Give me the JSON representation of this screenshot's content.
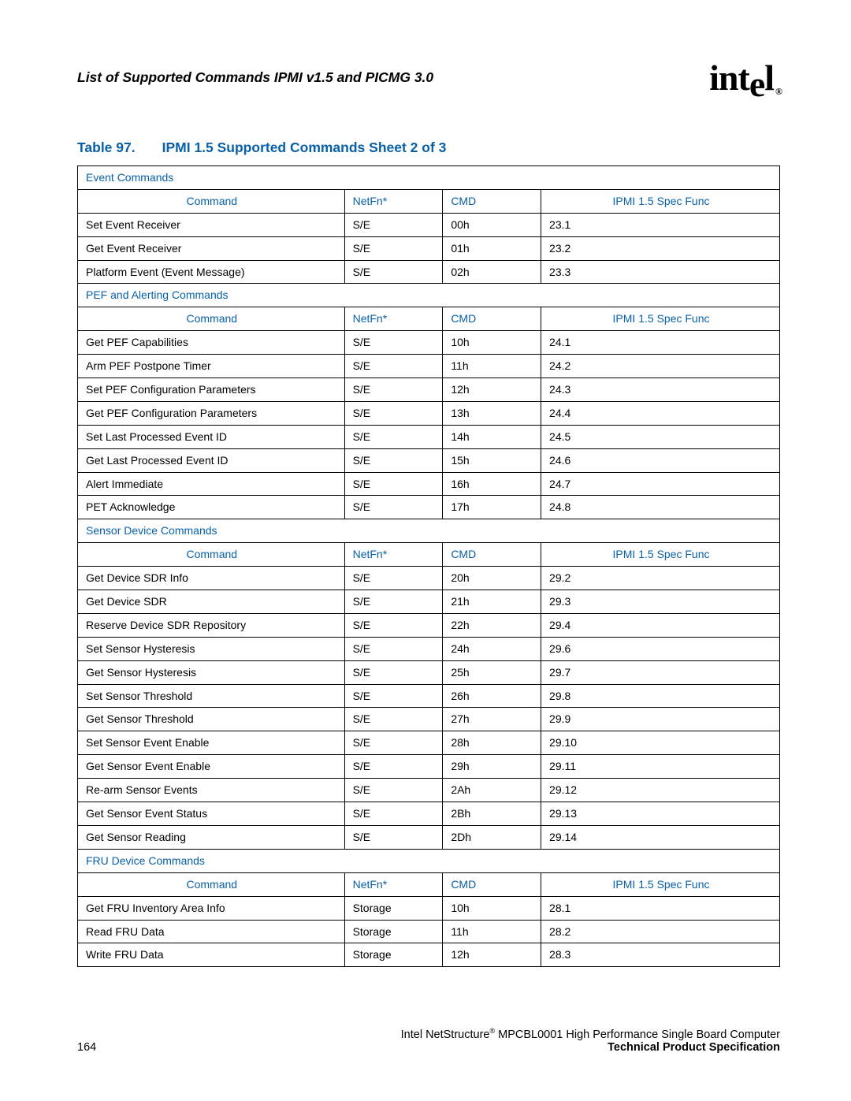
{
  "header": {
    "doc_title": "List of Supported Commands IPMI v1.5 and PICMG 3.0",
    "logo_text": "intel",
    "logo_reg": "®"
  },
  "caption": {
    "label": "Table 97.",
    "title": "IPMI 1.5 Supported Commands Sheet 2 of 3"
  },
  "columns": {
    "cmd": "Command",
    "netfn": "NetFn*",
    "code": "CMD",
    "spec": "IPMI 1.5 Spec Func"
  },
  "sections": [
    {
      "title": "Event Commands",
      "rows": [
        {
          "cmd": "Set Event Receiver",
          "netfn": "S/E",
          "code": "00h",
          "spec": "23.1"
        },
        {
          "cmd": "Get Event Receiver",
          "netfn": "S/E",
          "code": "01h",
          "spec": "23.2"
        },
        {
          "cmd": "Platform Event (Event Message)",
          "netfn": "S/E",
          "code": "02h",
          "spec": "23.3"
        }
      ]
    },
    {
      "title": "PEF and Alerting Commands",
      "rows": [
        {
          "cmd": "Get PEF Capabilities",
          "netfn": "S/E",
          "code": "10h",
          "spec": "24.1"
        },
        {
          "cmd": "Arm PEF Postpone Timer",
          "netfn": "S/E",
          "code": "11h",
          "spec": "24.2"
        },
        {
          "cmd": "Set PEF Configuration Parameters",
          "netfn": "S/E",
          "code": "12h",
          "spec": "24.3"
        },
        {
          "cmd": "Get PEF Configuration Parameters",
          "netfn": "S/E",
          "code": "13h",
          "spec": "24.4"
        },
        {
          "cmd": "Set Last Processed Event ID",
          "netfn": "S/E",
          "code": "14h",
          "spec": "24.5"
        },
        {
          "cmd": "Get Last Processed Event ID",
          "netfn": "S/E",
          "code": "15h",
          "spec": "24.6"
        },
        {
          "cmd": "Alert Immediate",
          "netfn": "S/E",
          "code": "16h",
          "spec": "24.7"
        },
        {
          "cmd": "PET Acknowledge",
          "netfn": "S/E",
          "code": "17h",
          "spec": "24.8"
        }
      ]
    },
    {
      "title": "Sensor Device Commands",
      "rows": [
        {
          "cmd": "Get Device SDR Info",
          "netfn": "S/E",
          "code": "20h",
          "spec": "29.2"
        },
        {
          "cmd": "Get Device SDR",
          "netfn": "S/E",
          "code": "21h",
          "spec": "29.3"
        },
        {
          "cmd": "Reserve Device SDR Repository",
          "netfn": "S/E",
          "code": "22h",
          "spec": "29.4"
        },
        {
          "cmd": "Set Sensor Hysteresis",
          "netfn": "S/E",
          "code": "24h",
          "spec": "29.6"
        },
        {
          "cmd": "Get Sensor Hysteresis",
          "netfn": "S/E",
          "code": "25h",
          "spec": "29.7"
        },
        {
          "cmd": "Set Sensor Threshold",
          "netfn": "S/E",
          "code": "26h",
          "spec": "29.8"
        },
        {
          "cmd": "Get Sensor Threshold",
          "netfn": "S/E",
          "code": "27h",
          "spec": "29.9"
        },
        {
          "cmd": "Set Sensor Event Enable",
          "netfn": "S/E",
          "code": "28h",
          "spec": "29.10"
        },
        {
          "cmd": "Get Sensor Event Enable",
          "netfn": "S/E",
          "code": "29h",
          "spec": "29.11"
        },
        {
          "cmd": "Re-arm Sensor Events",
          "netfn": "S/E",
          "code": "2Ah",
          "spec": "29.12"
        },
        {
          "cmd": "Get Sensor Event Status",
          "netfn": "S/E",
          "code": "2Bh",
          "spec": "29.13"
        },
        {
          "cmd": "Get Sensor Reading",
          "netfn": "S/E",
          "code": "2Dh",
          "spec": "29.14"
        }
      ]
    },
    {
      "title": "FRU Device Commands",
      "rows": [
        {
          "cmd": "Get FRU Inventory Area Info",
          "netfn": "Storage",
          "code": "10h",
          "spec": "28.1"
        },
        {
          "cmd": "Read FRU Data",
          "netfn": "Storage",
          "code": "11h",
          "spec": "28.2"
        },
        {
          "cmd": "Write FRU Data",
          "netfn": "Storage",
          "code": "12h",
          "spec": "28.3"
        }
      ]
    }
  ],
  "footer": {
    "page": "164",
    "line1_a": "Intel NetStructure",
    "line1_b": " MPCBL0001 High Performance Single Board Computer",
    "line2": "Technical Product Specification",
    "reg": "®"
  }
}
